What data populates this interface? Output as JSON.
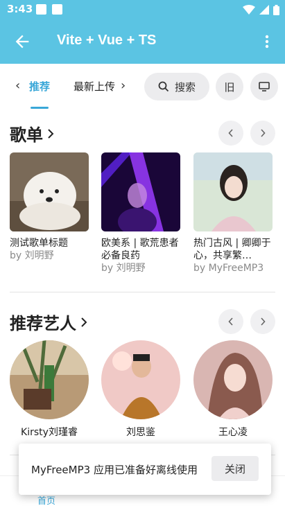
{
  "status_bar": {
    "time": "3:43"
  },
  "app_bar": {
    "title": "Vite + Vue + TS"
  },
  "tabs": {
    "items": [
      {
        "label": "推荐",
        "active": true
      },
      {
        "label": "最新上传",
        "active": false
      }
    ],
    "search_label": "搜索",
    "old_label": "旧"
  },
  "playlists": {
    "title": "歌单",
    "items": [
      {
        "name": "测试歌单标题",
        "by": "by 刘明野"
      },
      {
        "name": "欧美系 | 歌荒患者必备良药",
        "by": "by 刘明野"
      },
      {
        "name": "热门古风 | 卿卿于心，共享繁…",
        "by": "by MyFreeMP3"
      }
    ]
  },
  "artists": {
    "title": "推荐艺人",
    "items": [
      {
        "name": "Kirsty刘瑾睿"
      },
      {
        "name": "刘思鉴"
      },
      {
        "name": "王心凌"
      }
    ]
  },
  "toast": {
    "message": "MyFreeMP3 应用已准备好离线使用",
    "close_label": "关闭"
  },
  "bottom_nav": {
    "home_label": "首页"
  },
  "colors": {
    "accent": "#5bc4e3",
    "active_tab": "#3aa7d8"
  }
}
